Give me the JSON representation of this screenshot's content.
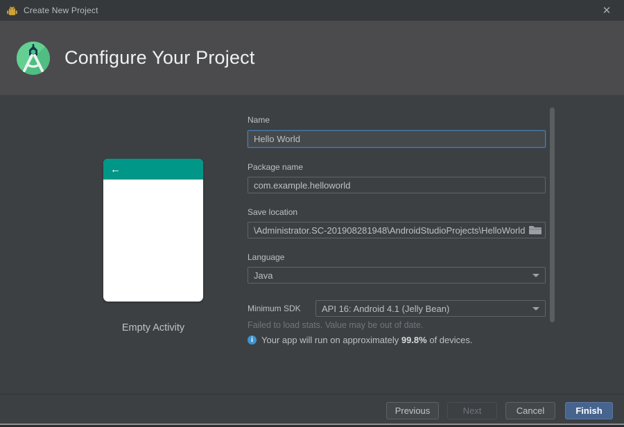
{
  "titlebar": {
    "title": "Create New Project",
    "close_glyph": "✕"
  },
  "header": {
    "title": "Configure Your Project"
  },
  "preview": {
    "caption": "Empty Activity",
    "back_arrow": "←",
    "appbar_color": "#009688"
  },
  "form": {
    "name": {
      "label": "Name",
      "value": "Hello World"
    },
    "package": {
      "label": "Package name",
      "value": "com.example.helloworld"
    },
    "save_location": {
      "label": "Save location",
      "value": "\\Administrator.SC-201908281948\\AndroidStudioProjects\\HelloWorld"
    },
    "language": {
      "label": "Language",
      "value": "Java"
    },
    "min_sdk": {
      "label": "Minimum SDK",
      "value": "API 16: Android 4.1 (Jelly Bean)"
    },
    "stats_warning": "Failed to load stats. Value may be out of date.",
    "device_info": {
      "prefix": "Your app will run on approximately ",
      "percent": "99.8%",
      "suffix": " of devices.",
      "info_glyph": "i"
    }
  },
  "footer": {
    "previous": "Previous",
    "next": "Next",
    "cancel": "Cancel",
    "finish": "Finish"
  },
  "colors": {
    "accent_blue": "#47648f",
    "focus_border": "#4a7db1",
    "teal_appbar": "#009688",
    "info_blue": "#3e94d1",
    "header_bg": "#4b4b4d",
    "main_bg": "#3c4043",
    "titlebar_bg": "#36393b"
  }
}
